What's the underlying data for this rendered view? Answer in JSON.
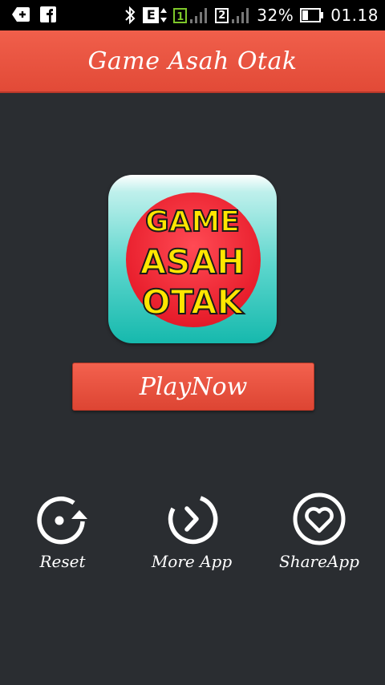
{
  "status_bar": {
    "battery_percent": "32%",
    "time": "01.18",
    "network_type": "E",
    "sim1_label": "1",
    "sim2_label": "2",
    "icons": [
      "add-icon",
      "facebook-icon",
      "bluetooth-icon",
      "network-e-icon",
      "sim1-signal-icon",
      "sim2-signal-icon",
      "battery-icon"
    ]
  },
  "appbar": {
    "title": "Game Asah Otak"
  },
  "logo": {
    "line1": "GAME",
    "line2": "ASAH",
    "line3": "OTAK"
  },
  "play_button": {
    "label": "PlayNow"
  },
  "actions": [
    {
      "label": "Reset",
      "icon": "reset-icon"
    },
    {
      "label": "More App",
      "icon": "chevron-right-icon"
    },
    {
      "label": "ShareApp",
      "icon": "heart-icon"
    }
  ],
  "colors": {
    "accent": "#e9503d",
    "background": "#2a2d31",
    "logo_red": "#e81e2c",
    "logo_yellow": "#ffe600",
    "logo_teal": "#16b9ad"
  }
}
